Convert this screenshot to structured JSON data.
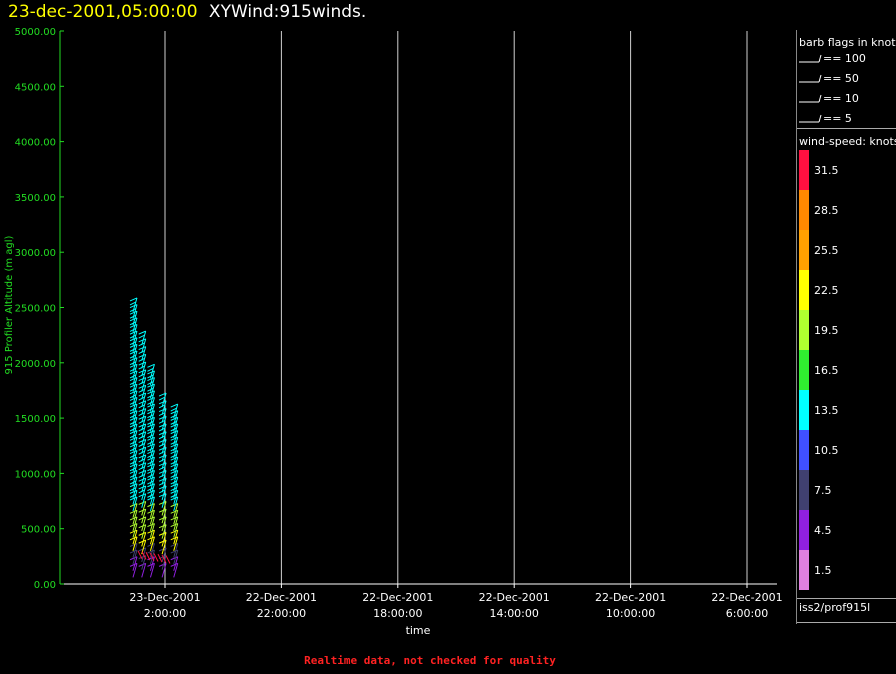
{
  "title": {
    "time": "23-dec-2001,05:00:00",
    "name": "XYWind:915winds."
  },
  "chart_data": {
    "type": "scatter",
    "ylabel": "915 Profiler Altitude (m agl)",
    "xlabel": "time",
    "ylim": [
      0,
      5000
    ],
    "y_ticks": [
      "5000.00",
      "4500.00",
      "4000.00",
      "3500.00",
      "3000.00",
      "2500.00",
      "2000.00",
      "1500.00",
      "1000.00",
      "500.00",
      "0.00"
    ],
    "x_ticks": [
      {
        "date": "23-Dec-2001",
        "time": "2:00:00"
      },
      {
        "date": "22-Dec-2001",
        "time": "22:00:00"
      },
      {
        "date": "22-Dec-2001",
        "time": "18:00:00"
      },
      {
        "date": "22-Dec-2001",
        "time": "14:00:00"
      },
      {
        "date": "22-Dec-2001",
        "time": "10:00:00"
      },
      {
        "date": "22-Dec-2001",
        "time": "6:00:00"
      }
    ],
    "x_direction": "reversed",
    "grid": "vertical lines at x ticks",
    "columns": [
      {
        "hours_before_0200": 0.3,
        "top_m": 1500
      },
      {
        "hours_before_0200": -0.1,
        "top_m": 1600
      },
      {
        "hours_before_0200": -0.5,
        "top_m": 1900
      },
      {
        "hours_before_0200": -0.8,
        "top_m": 2200
      },
      {
        "hours_before_0200": -1.1,
        "top_m": 2500
      }
    ],
    "color_bar": {
      "title": "wind-speed: knots",
      "entries": [
        {
          "label": "31.5",
          "color": "#ff1040"
        },
        {
          "label": "28.5",
          "color": "#ff8800"
        },
        {
          "label": "25.5",
          "color": "#ffa000"
        },
        {
          "label": "22.5",
          "color": "#ffff00"
        },
        {
          "label": "19.5",
          "color": "#b0ff30"
        },
        {
          "label": "16.5",
          "color": "#30ee30"
        },
        {
          "label": "13.5",
          "color": "#00ffff"
        },
        {
          "label": "10.5",
          "color": "#4050ff"
        },
        {
          "label": "7.5",
          "color": "#404070"
        },
        {
          "label": "4.5",
          "color": "#9020e0"
        },
        {
          "label": "1.5",
          "color": "#e080e0"
        }
      ]
    }
  },
  "legend": {
    "barb_title": "barb flags in knots",
    "flags": [
      "== 100",
      "== 50",
      "== 10",
      "== 5"
    ],
    "source": "iss2/prof915l"
  },
  "footer": "Realtime data, not checked for quality"
}
